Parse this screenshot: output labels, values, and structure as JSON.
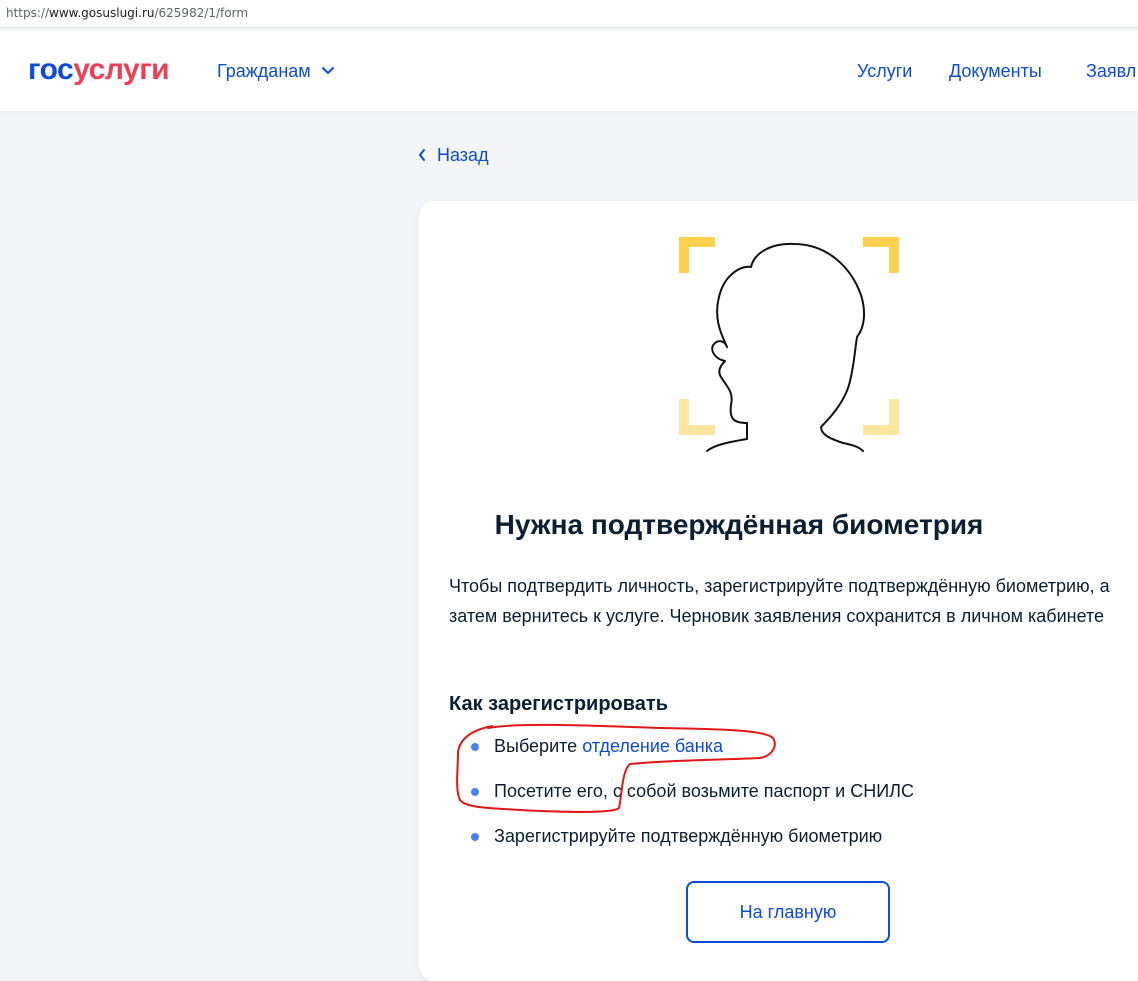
{
  "browser": {
    "url_scheme": "https://",
    "url_host": "www.gosuslugi.ru",
    "url_path": "/625982/1/form"
  },
  "header": {
    "logo_part1": "гос",
    "logo_part2": "услуги",
    "citizens_label": "Гражданам",
    "nav": [
      "Услуги",
      "Документы",
      "Заявл"
    ]
  },
  "back_label": "Назад",
  "card": {
    "title": "Нужна подтверждённая биометрия",
    "description": "Чтобы подтвердить личность, зарегистрируйте подтверждённую биометрию, а затем вернитесь к услуге. Черновик заявления сохранится в личном кабинете",
    "howto_title": "Как зарегистрировать",
    "steps": {
      "s1_text": "Выберите ",
      "s1_link": "отделение банка",
      "s2": "Посетите его, с собой возьмите паспорт и СНИЛС",
      "s3": "Зарегистрируйте подтверждённую биометрию"
    },
    "home_button": "На главную"
  },
  "colors": {
    "brand_blue": "#0d4cd3",
    "brand_red": "#ee3f58",
    "frame_yellow": "#fdd14f",
    "annotation_red": "#e01818"
  }
}
